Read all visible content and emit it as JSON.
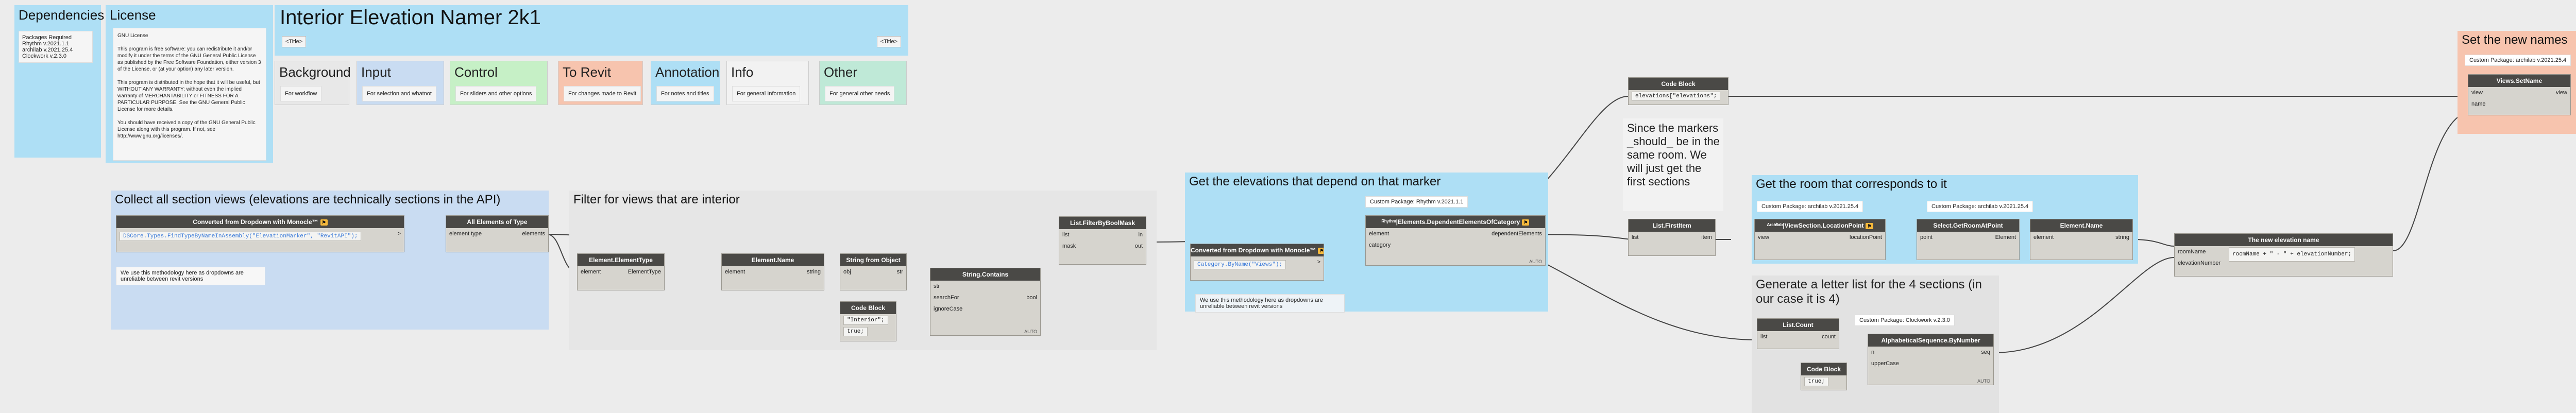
{
  "dependencies": {
    "title": "Dependencies",
    "text": "Packages Required\nRhythm v.2021.1.1\narchilab v.2021.25.4\nClockwork v.2.3.0"
  },
  "license": {
    "title": "License",
    "text": "GNU License\n\nThis program is free software: you can redistribute it and/or modify it under the terms of the GNU General Public License as published by the Free Software Foundation, either version 3 of the License, or (at your option) any later version.\n\nThis program is distributed in the hope that it will be useful, but WITHOUT ANY WARRANTY; without even the implied warranty of MERCHANTABILITY or FITNESS FOR A PARTICULAR PURPOSE. See the GNU General Public License for more details.\n\nYou should have received a copy of the GNU General Public License along with this program. If not, see http://www.gnu.org/licenses/."
  },
  "title_panel": {
    "title": "Interior Elevation Namer 2k1",
    "btn_left": "<Title>",
    "btn_right": "<Title>"
  },
  "legend": [
    {
      "title": "Background",
      "note": "For workflow",
      "color": "#e8e8e8"
    },
    {
      "title": "Input",
      "note": "For selection and whatnot",
      "color": "#c9dcf2"
    },
    {
      "title": "Control",
      "note": "For sliders and other options",
      "color": "#c6f0c6"
    },
    {
      "title": "To Revit",
      "note": "For changes made to Revit",
      "color": "#f7c4ae"
    },
    {
      "title": "Annotation",
      "note": "For notes and titles",
      "color": "#aedff5"
    },
    {
      "title": "Info",
      "note": "For general Information",
      "color": "#f2f2f2"
    },
    {
      "title": "Other",
      "note": "For general other needs",
      "color": "#bfe9d7"
    }
  ],
  "groups": {
    "collect": "Collect all section views (elevations are technically sections in the API)",
    "filter": "Filter for views that are interior",
    "elevs": "Get the elevations that depend on that marker",
    "room": "Get the room that corresponds to it",
    "letters": "Generate a letter list for the 4 sections (in our case it is 4)",
    "setnames": "Set the new names",
    "since": "Since the markers _should_ be in the same room. We will just get the first sections"
  },
  "notes": {
    "dropdown1": "We use this methodology here as dropdowns are unreliable between revit versions",
    "dropdown2": "We use this methodology here as dropdowns are unreliable between revit versions"
  },
  "tags": {
    "rhythm": "Custom Package: Rhythm v.2021.1.1",
    "archilab1": "Custom Package: archilab v.2021.25.4",
    "archilab2": "Custom Package: archilab v.2021.25.4",
    "clockwork": "Custom Package: Clockwork v.2.3.0",
    "archilab3": "Custom Package: archilab v.2021.25.4"
  },
  "nodes": {
    "monocle1": {
      "title": "Converted from Dropdown with Monocle™",
      "code": "DSCore.Types.FindTypeByNameInAssembly(\"ElevationMarker\", \"RevitAPI\");",
      "out": ">"
    },
    "allel": {
      "title": "All Elements of Type",
      "in": "element type",
      "out": "elements"
    },
    "eltype": {
      "title": "Element.ElementType",
      "in": "element",
      "out": "ElementType"
    },
    "elname": {
      "title": "Element.Name",
      "in": "element",
      "out": "string"
    },
    "strfrom": {
      "title": "String from Object",
      "in": "obj",
      "out": "str"
    },
    "code1": {
      "title": "Code Block",
      "l1": "\"Interior\";",
      "l2": "true;"
    },
    "strcont": {
      "title": "String.Contains",
      "in1": "str",
      "in2": "searchFor",
      "in3": "ignoreCase",
      "out": "bool"
    },
    "filter": {
      "title": "List.FilterByBoolMask",
      "in1": "list",
      "in2": "mask",
      "out1": "in",
      "out2": "out"
    },
    "monocle2": {
      "title": "Converted from Dropdown with Monocle™",
      "code": "Category.ByName(\"Views\");",
      "out": ">"
    },
    "dep": {
      "title": "ᴿʰʸᵗʰᵐ|Elements.DependentElementsOfCategory",
      "in1": "element",
      "in2": "category",
      "out": "dependentElements"
    },
    "code2": {
      "title": "Code Block",
      "code": "elevations[\"elevations\";"
    },
    "first": {
      "title": "List.FirstItem",
      "in": "list",
      "out": "item"
    },
    "loc": {
      "title": "ᴬʳᶜʰⁱˡᵃᵇ|ViewSection.LocationPoint",
      "in": "view",
      "out": "locationPoint"
    },
    "sel": {
      "title": "Select.GetRoomAtPoint",
      "in": "point",
      "out": "Element"
    },
    "elname2": {
      "title": "Element.Name",
      "in": "element",
      "out": "string"
    },
    "count": {
      "title": "List.Count",
      "in": "list",
      "out": "count"
    },
    "code3": {
      "title": "Code Block",
      "l1": "true;"
    },
    "alpha": {
      "title": "AlphabeticalSequence.ByNumber",
      "in1": "n",
      "in2": "upperCase",
      "out": "seq"
    },
    "newname": {
      "title": "The new elevation name",
      "code": "roomName + \" - \" + elevationNumber;",
      "in1": "roomName",
      "in2": "elevationNumber"
    },
    "setname": {
      "title": "Views.SetName",
      "in1": "view",
      "in2": "name",
      "out": "view"
    }
  },
  "footer_label": "AUTO"
}
